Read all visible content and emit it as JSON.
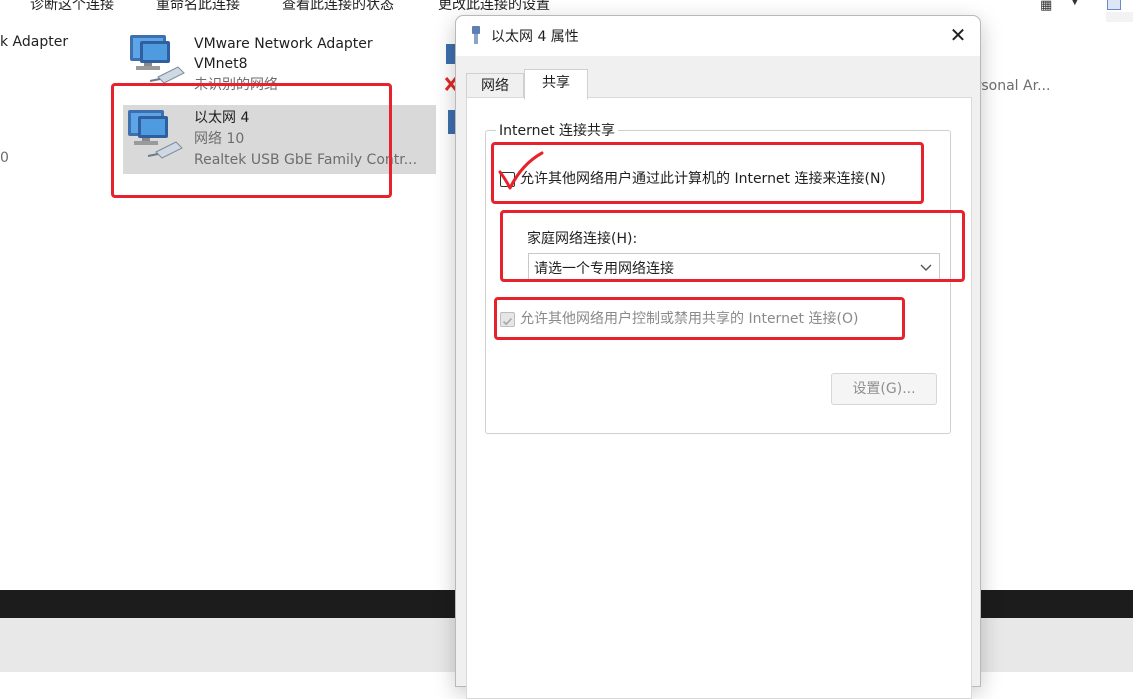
{
  "toolbar": {
    "diagnose": "诊断这个连接",
    "rename": "重命名此连接",
    "view_status": "查看此连接的状态",
    "change_settings": "更改此连接的设置"
  },
  "connections": {
    "left_partial": {
      "name": "k Adapter",
      "count_suffix": "0"
    },
    "vmnet8": {
      "name_line1": "VMware Network Adapter",
      "name_line2": "VMnet8",
      "status": "未识别的网络"
    },
    "ethernet4": {
      "name": "以太网 4",
      "network": "网络 10",
      "device": "Realtek USB GbE Family Contr..."
    },
    "right_partial": {
      "text": "ersonal Ar..."
    }
  },
  "dialog": {
    "title": "以太网 4 属性",
    "close_glyph": "✕",
    "tabs": [
      {
        "label": "网络"
      },
      {
        "label": "共享"
      }
    ],
    "group_title": "Internet 连接共享",
    "allow_share_label": "允许其他网络用户通过此计算机的 Internet 连接来连接(N)",
    "allow_share_checked": false,
    "home_network_label": "家庭网络连接(H):",
    "home_network_value": "请选一个专用网络连接",
    "allow_control_label": "允许其他网络用户控制或禁用共享的 Internet 连接(O)",
    "allow_control_checked": true,
    "allow_control_enabled": false,
    "settings_button": "设置(G)..."
  },
  "annotation_color": "#e8222c"
}
